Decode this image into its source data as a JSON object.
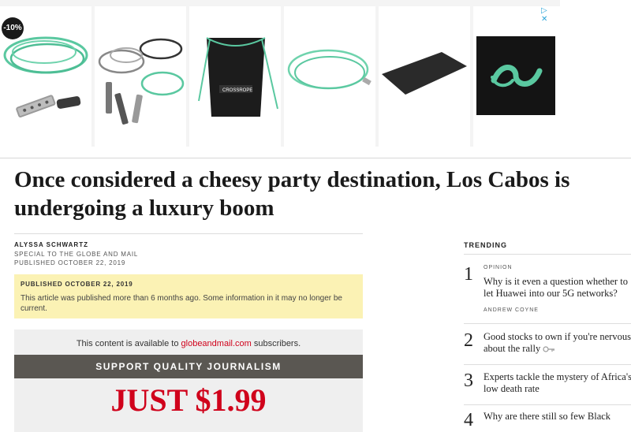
{
  "ad": {
    "discount_badge": "-10%",
    "choice_icons": "▷ ✕",
    "logo_color": "#5ac8a0",
    "tiles": [
      {
        "name": "jump-rope-weighted"
      },
      {
        "name": "jump-rope-set"
      },
      {
        "name": "crossrope-bag"
      },
      {
        "name": "jump-rope-cable"
      },
      {
        "name": "exercise-mat"
      },
      {
        "name": "crossrope-logo"
      }
    ]
  },
  "article": {
    "headline": "Once considered a cheesy party destination, Los Cabos is undergoing a luxury boom",
    "author": "ALYSSA SCHWARTZ",
    "affiliation": "SPECIAL TO THE GLOBE AND MAIL",
    "published": "PUBLISHED OCTOBER 22, 2019"
  },
  "notice": {
    "heading": "PUBLISHED OCTOBER 22, 2019",
    "body": "This article was published more than 6 months ago. Some information in it may no longer be current."
  },
  "paywall": {
    "available_prefix": "This content is available to ",
    "available_link": "globeandmail.com",
    "available_suffix": " subscribers.",
    "banner": "SUPPORT QUALITY JOURNALISM",
    "price": "JUST $1.99",
    "price_color": "#d0021b"
  },
  "trending": {
    "heading": "TRENDING",
    "items": [
      {
        "number": "1",
        "tag": "OPINION",
        "title": "Why is it even a question whether to let Huawei into our 5G networks?",
        "author": "ANDREW COYNE"
      },
      {
        "number": "2",
        "title": "Good stocks to own if you're nervous about the rally"
      },
      {
        "number": "3",
        "title": "Experts tackle the mystery of Africa's low death rate"
      },
      {
        "number": "4",
        "title": "Why are there still so few Black"
      }
    ]
  }
}
